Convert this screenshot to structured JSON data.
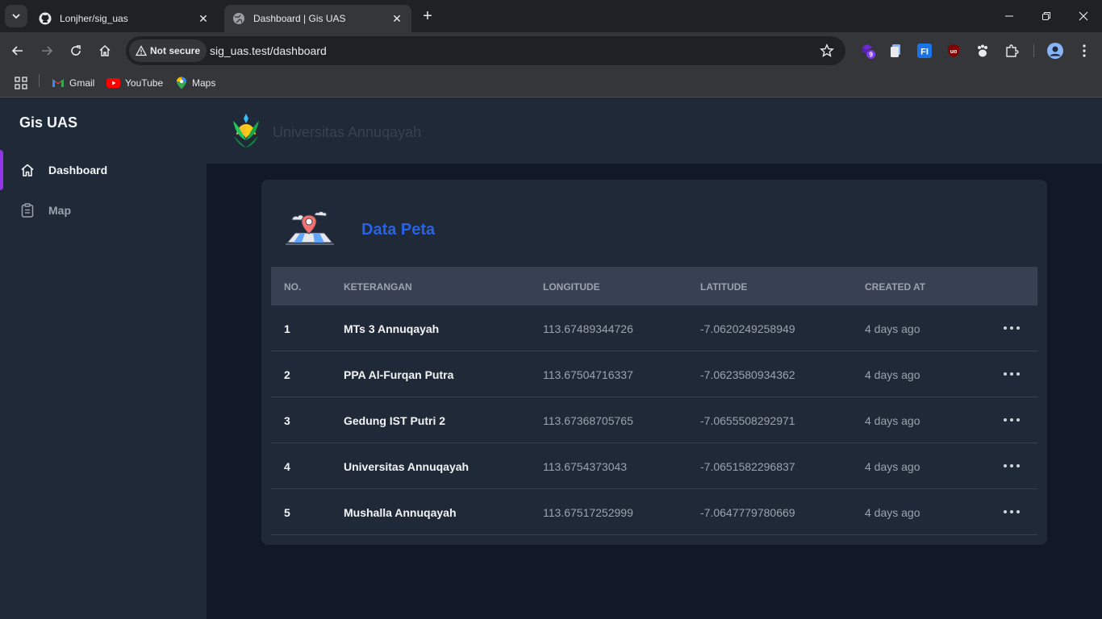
{
  "browser": {
    "tabs": [
      {
        "title": "Lonjher/sig_uas",
        "icon": "github-icon"
      },
      {
        "title": "Dashboard | Gis UAS",
        "icon": "globe-icon"
      }
    ],
    "security_label": "Not secure",
    "url": "sig_uas.test/dashboard",
    "extension_badge": "9",
    "bookmarks": [
      {
        "label": "Gmail",
        "icon": "gmail-icon"
      },
      {
        "label": "YouTube",
        "icon": "youtube-icon"
      },
      {
        "label": "Maps",
        "icon": "maps-icon"
      }
    ]
  },
  "sidebar": {
    "brand": "Gis UAS",
    "items": [
      {
        "label": "Dashboard",
        "icon": "home-icon",
        "active": true
      },
      {
        "label": "Map",
        "icon": "clipboard-icon",
        "active": false
      }
    ]
  },
  "header": {
    "org_name": "Universitas Annuqayah"
  },
  "card": {
    "title": "Data Peta",
    "columns": [
      "No.",
      "Keterangan",
      "Longitude",
      "Latitude",
      "Created At"
    ],
    "rows": [
      {
        "no": "1",
        "name": "MTs 3 Annuqayah",
        "longitude": "113.67489344726",
        "latitude": "-7.0620249258949",
        "created": "4 days ago"
      },
      {
        "no": "2",
        "name": "PPA Al-Furqan Putra",
        "longitude": "113.67504716337",
        "latitude": "-7.0623580934362",
        "created": "4 days ago"
      },
      {
        "no": "3",
        "name": "Gedung IST Putri 2",
        "longitude": "113.67368705765",
        "latitude": "-7.0655508292971",
        "created": "4 days ago"
      },
      {
        "no": "4",
        "name": "Universitas Annuqayah",
        "longitude": "113.6754373043",
        "latitude": "-7.0651582296837",
        "created": "4 days ago"
      },
      {
        "no": "5",
        "name": "Mushalla Annuqayah",
        "longitude": "113.67517252999",
        "latitude": "-7.0647779780669",
        "created": "4 days ago"
      }
    ]
  },
  "colors": {
    "accent": "#9333ea",
    "title_blue": "#2563eb",
    "sidebar_bg": "#1f2937",
    "page_bg": "#111827"
  }
}
